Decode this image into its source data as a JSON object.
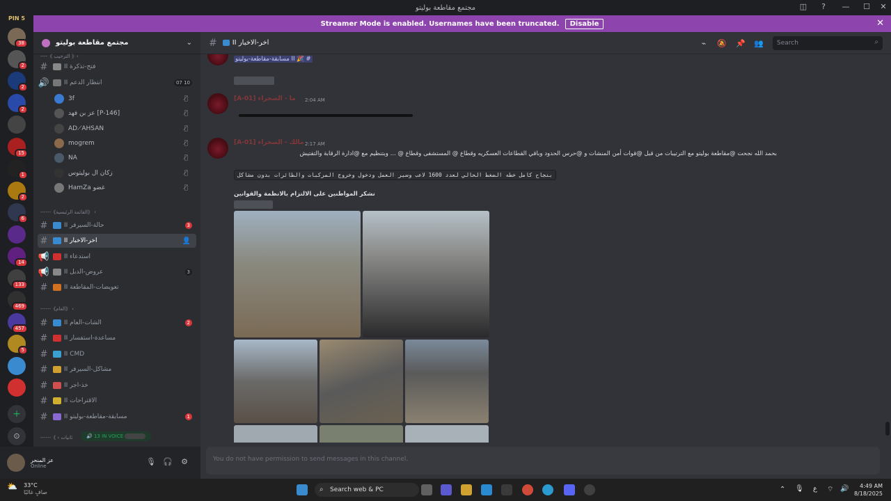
{
  "window": {
    "title": "مجتمع مقاطعة بوليتو",
    "controls": [
      "◫",
      "?",
      "—",
      "☐",
      "✕"
    ]
  },
  "banner": {
    "text": "Streamer Mode is enabled. Usernames have been truncated.",
    "button": "Disable"
  },
  "servers": [
    {
      "badge": "38",
      "color": "#7a6a55"
    },
    {
      "badge": "2",
      "color": "#555"
    },
    {
      "badge": "2",
      "color": "#1a3a7a"
    },
    {
      "badge": "2",
      "color": "#2a4aaa"
    },
    {
      "badge": "",
      "color": "#444"
    },
    {
      "badge": "15",
      "color": "#aa2020"
    },
    {
      "badge": "1",
      "color": "#222"
    },
    {
      "badge": "2",
      "color": "#aa7a10"
    },
    {
      "badge": "6",
      "color": "#303850"
    },
    {
      "badge": "",
      "color": "#5a2a8a"
    },
    {
      "badge": "14",
      "color": "#602080"
    },
    {
      "badge": "133",
      "color": "#404040"
    },
    {
      "badge": "469",
      "color": "#303030"
    },
    {
      "badge": "457",
      "color": "#4a3aa0"
    },
    {
      "badge": "5",
      "color": "#b08a20"
    },
    {
      "badge": "",
      "color": "#3a8ad0"
    },
    {
      "badge": "",
      "color": "#d03030"
    }
  ],
  "pin_badge": "PIN 5",
  "guild": {
    "name": "مجتمع مقاطعة بوليتو",
    "channels": [
      {
        "name": "II فتح-تذكرة",
        "type": "#",
        "count": "",
        "emoji": "#888"
      },
      {
        "name": "II انتظار الدعم",
        "type": "🔊",
        "count": "07 10",
        "emoji": "#777"
      },
      {
        "name": "II حالة-السيرفر",
        "type": "#",
        "count": "3",
        "emoji": "#3a8ad0"
      },
      {
        "name": "II اخر-الاخبار",
        "type": "#",
        "count": "",
        "emoji": "#3a8ad0"
      },
      {
        "name": "II استدعاء",
        "type": "📢",
        "count": "",
        "emoji": "#d03030"
      },
      {
        "name": "II عروض-الدبل",
        "type": "📢",
        "count": "3",
        "emoji": "#888"
      },
      {
        "name": "II تعويضات-المقاطعة",
        "type": "#",
        "count": "",
        "emoji": "#d07020"
      },
      {
        "name": "II الشات-العام",
        "type": "#",
        "count": "2",
        "emoji": "#3a8ad0"
      },
      {
        "name": "II مساعدة-استفسار",
        "type": "#",
        "count": "",
        "emoji": "#d03030"
      },
      {
        "name": "II CMD",
        "type": "#",
        "count": "",
        "emoji": "#3aa0d0"
      },
      {
        "name": "II مشاكل-السيرفر",
        "type": "#",
        "count": "",
        "emoji": "#d0a030"
      },
      {
        "name": "II خذ-اجر",
        "type": "#",
        "count": "",
        "emoji": "#d05050"
      },
      {
        "name": "II الاقتراحات",
        "type": "#",
        "count": "",
        "emoji": "#d0b030"
      },
      {
        "name": "II مسابقة-مقاطعة-بوليتو",
        "type": "#",
        "count": "1",
        "emoji": "#8a6ad0"
      }
    ],
    "voice_users": [
      "3f",
      "عز بن فهد [P-146]",
      "AD⟋AHSAN",
      "mogrem",
      "NA",
      "زكان ال بوليتوس",
      "HamZa غضو"
    ],
    "categories": [
      "------《القائمة الرئيسية》 ‹",
      "------《العام》 ‹",
      "------《 ‹ ثانيات"
    ],
    "top_category": "----《 الترحيب 》‹"
  },
  "voice_pill": "13 IN VOICE",
  "user": {
    "name": "عز المنحر",
    "status": "Online"
  },
  "channel_header": {
    "name": "II اخر-الاخبار",
    "search_placeholder": "Search"
  },
  "messages": {
    "top_mention": "مسابقة-مقاطعة-بوليتو II 🎉 #",
    "msg1_user": "[A-01] ما - الصحراء",
    "msg1_time": "2:04 AM",
    "msg2_user": "[A-01] مالك - الصحراء",
    "msg2_time": "2:17 AM",
    "line1": "بحمد الله نجحت @مقاطعة بوليتو مع الترتيبات من قبل @قوات أمن المنشات و @حرس الحدود وباقي القطاعات العسكريه وقطاع @ المستشفى وقطاع @ ... وبتنظيم مع @ادارة الرقابة والتفتيش",
    "code": "بنجاح كامل خطه الضغط الحالي لعدد 1600 لاعب وسير العمل ودخول وخروج المركبات والطائرات بدون مشاكل",
    "thanks": "نشكر المواطنين على الالتزام بالانظمة والقوانين",
    "composer": "You do not have permission to send messages in this channel."
  },
  "taskbar": {
    "weather_temp": "33°C",
    "weather_text": "صافٍ غالبًا",
    "search": "Search web & PC",
    "time": "4:49 AM",
    "date": "8/18/2025",
    "lang": "ع"
  }
}
